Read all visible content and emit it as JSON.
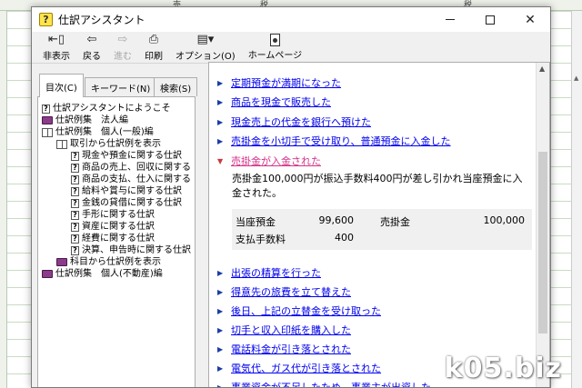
{
  "window": {
    "title": "仕訳アシスタント",
    "controls": {
      "minimize": "–",
      "maximize": "□",
      "close": "✕"
    }
  },
  "toolbar": {
    "buttons": [
      {
        "label": "非表示",
        "icon": "hide-icon"
      },
      {
        "label": "戻る",
        "icon": "back-arrow-icon"
      },
      {
        "label": "進む",
        "icon": "forward-arrow-icon",
        "disabled": true
      },
      {
        "label": "印刷",
        "icon": "printer-icon"
      },
      {
        "label": "オプション(O)",
        "icon": "options-icon"
      },
      {
        "label": "ホームページ",
        "icon": "homepage-icon"
      }
    ]
  },
  "tabs": {
    "contents": "目次(C)",
    "keyword": "キーワード(N)",
    "search": "検索(S)"
  },
  "tree": [
    {
      "label": "仕訳アシスタントにようこそ",
      "icon": "help-page-icon",
      "level": 0
    },
    {
      "label": "仕訳例集　法人編",
      "icon": "book-icon",
      "level": 0
    },
    {
      "label": "仕訳例集　個人(一般)編",
      "icon": "open-book-icon",
      "level": 0
    },
    {
      "label": "取引から仕訳例を表示",
      "icon": "open-book-icon",
      "level": 1
    },
    {
      "label": "現金や預金に関する仕訳",
      "icon": "help-page-icon",
      "level": 2
    },
    {
      "label": "商品の売上、回収に関する",
      "icon": "help-page-icon",
      "level": 2
    },
    {
      "label": "商品の支払、仕入に関する",
      "icon": "help-page-icon",
      "level": 2
    },
    {
      "label": "給料や賞与に関する仕訳",
      "icon": "help-page-icon",
      "level": 2
    },
    {
      "label": "金銭の貸借に関する仕訳",
      "icon": "help-page-icon",
      "level": 2
    },
    {
      "label": "手形に関する仕訳",
      "icon": "help-page-icon",
      "level": 2
    },
    {
      "label": "資産に関する仕訳",
      "icon": "help-page-icon",
      "level": 2
    },
    {
      "label": "経費に関する仕訳",
      "icon": "help-page-icon",
      "level": 2
    },
    {
      "label": "決算、申告時に関する仕訳",
      "icon": "help-page-icon",
      "level": 2
    },
    {
      "label": "科目から仕訳例を表示",
      "icon": "book-icon",
      "level": 1
    },
    {
      "label": "仕訳例集　個人(不動産)編",
      "icon": "book-icon",
      "level": 0
    }
  ],
  "topics_before": [
    "定期預金が満期になった",
    "商品を現金で販売した",
    "現金売上の代金を銀行へ預けた",
    "売掛金を小切手で受け取り、普通預金に入金した"
  ],
  "selected_topic": {
    "title": "売掛金が入金された",
    "description": "売掛金100,000円が振込手数料400円が差し引かれ当座預金に入金された。",
    "entries": [
      {
        "debit_account": "当座預金",
        "debit_amount": "99,600",
        "credit_account": "売掛金",
        "credit_amount": "100,000"
      },
      {
        "debit_account": "支払手数料",
        "debit_amount": "400",
        "credit_account": "",
        "credit_amount": ""
      }
    ]
  },
  "topics_after": [
    "出張の精算を行った",
    "得意先の旅費を立て替えた",
    "後日、上記の立替金を受け取った",
    "切手と収入印紙を購入した",
    "電話料金が引き落とされた",
    "電気代、ガス代が引き落とされた",
    "事業資金が不足したため、事業主が出資した"
  ],
  "spreadsheet_headers": [
    "売",
    "税",
    "税"
  ],
  "watermark": "k05.biz",
  "colors": {
    "link": "#0000ee",
    "visited_link": "#d4328a",
    "bullet": "#1a3da8",
    "open_bullet": "#c83a3a"
  }
}
